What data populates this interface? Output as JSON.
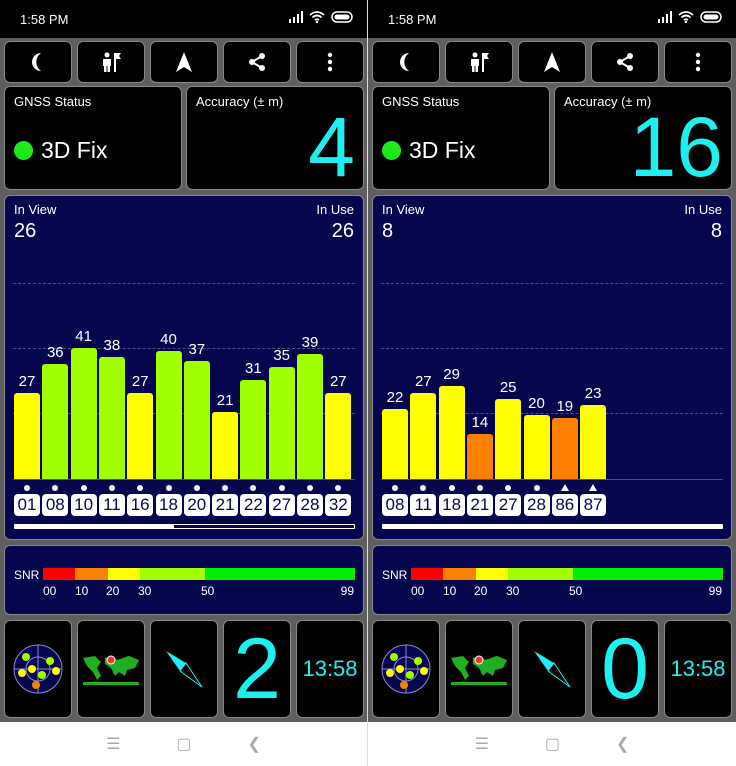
{
  "colors": {
    "accent": "#1ef0f0",
    "panel": "#06064f",
    "fix": "#1ee81e",
    "snr_red": "#ff0000",
    "snr_orange": "#ff8000",
    "snr_yellow": "#ffff00",
    "snr_yellowgreen": "#a0ff00",
    "snr_green": "#00ee00"
  },
  "panels": [
    {
      "status_time": "1:58 PM",
      "toolbar": [
        "moon-icon",
        "person-flag-icon",
        "navigation-arrow-icon",
        "share-icon",
        "more-vert-icon"
      ],
      "gnss_label": "GNSS Status",
      "fix_text": "3D Fix",
      "accuracy_label": "Accuracy (± m)",
      "accuracy_value": "4",
      "in_view_label": "In View",
      "in_view": "26",
      "in_use_label": "In Use",
      "in_use": "26",
      "scroll_fraction": 0.47,
      "chart_data": {
        "type": "bar",
        "categories": [
          "01",
          "08",
          "10",
          "11",
          "16",
          "18",
          "20",
          "21",
          "22",
          "27",
          "28",
          "32"
        ],
        "values": [
          27,
          36,
          41,
          38,
          27,
          40,
          37,
          21,
          31,
          35,
          39,
          27
        ],
        "markers": [
          "dot",
          "dot",
          "dot",
          "dot",
          "dot",
          "dot",
          "dot",
          "dot",
          "dot",
          "dot",
          "dot",
          "dot"
        ],
        "ylim": [
          0,
          70
        ],
        "grid": true
      },
      "snr": {
        "label": "SNR",
        "ticks": [
          "00",
          "10",
          "20",
          "30",
          "50",
          "99"
        ]
      },
      "satellites_used": "2",
      "clock": "13:58",
      "bottom_icons": [
        "sky-plot-icon",
        "world-map-icon",
        "compass-icon"
      ]
    },
    {
      "status_time": "1:58 PM",
      "toolbar": [
        "moon-icon",
        "person-flag-icon",
        "navigation-arrow-icon",
        "share-icon",
        "more-vert-icon"
      ],
      "gnss_label": "GNSS Status",
      "fix_text": "3D Fix",
      "accuracy_label": "Accuracy (± m)",
      "accuracy_value": "16",
      "in_view_label": "In View",
      "in_view": "8",
      "in_use_label": "In Use",
      "in_use": "8",
      "scroll_fraction": 1.0,
      "chart_data": {
        "type": "bar",
        "categories": [
          "08",
          "11",
          "18",
          "21",
          "27",
          "28",
          "86",
          "87"
        ],
        "values": [
          22,
          27,
          29,
          14,
          25,
          20,
          19,
          23
        ],
        "markers": [
          "dot",
          "dot",
          "dot",
          "dot",
          "dot",
          "dot",
          "triangle",
          "triangle"
        ],
        "ylim": [
          0,
          70
        ],
        "grid": true
      },
      "snr": {
        "label": "SNR",
        "ticks": [
          "00",
          "10",
          "20",
          "30",
          "50",
          "99"
        ]
      },
      "satellites_used": "0",
      "clock": "13:58",
      "bottom_icons": [
        "sky-plot-icon",
        "world-map-icon",
        "compass-icon"
      ]
    }
  ],
  "navbar": [
    "menu-icon",
    "home-icon",
    "back-icon"
  ]
}
